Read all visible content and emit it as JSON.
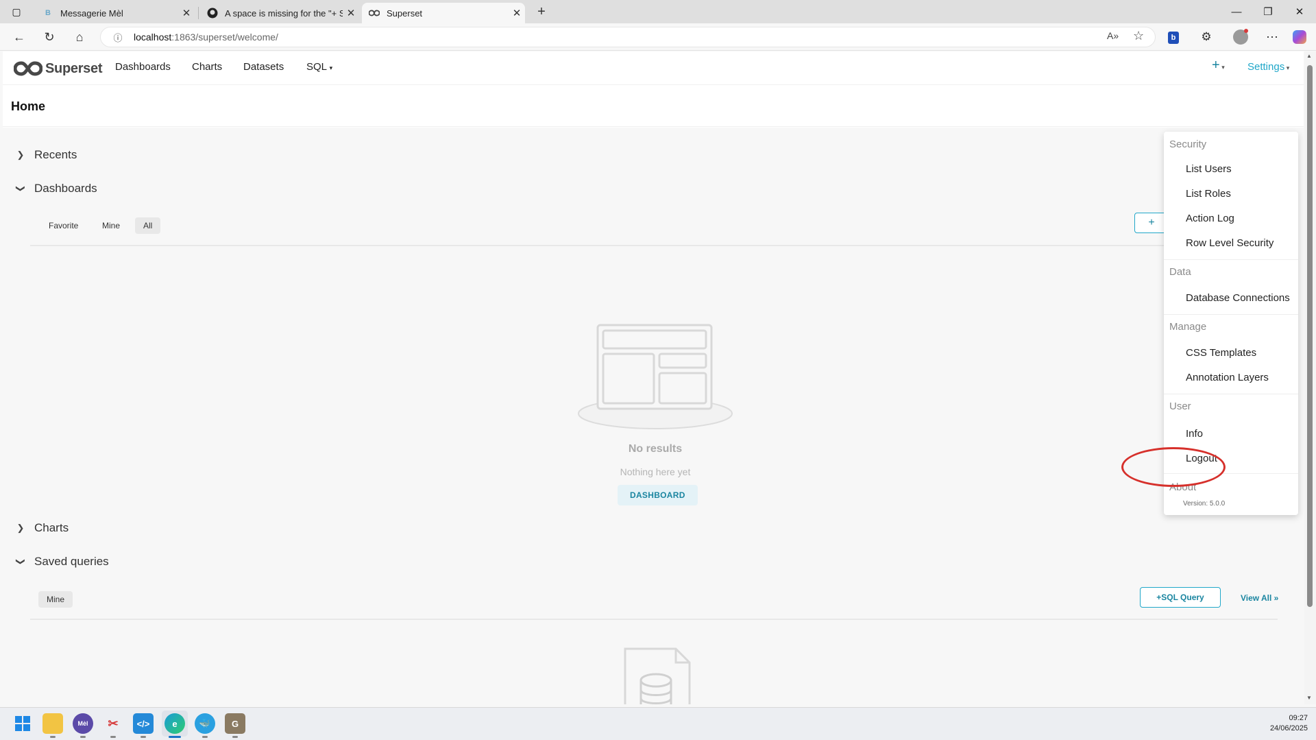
{
  "browser": {
    "tabs": [
      {
        "title": "Messagerie Mèl",
        "icon": "mail-favicon",
        "active": false
      },
      {
        "title": "A space is missing for the \"+ SQL",
        "icon": "github-icon",
        "active": false
      },
      {
        "title": "Superset",
        "icon": "superset-favicon",
        "active": true
      }
    ],
    "url": {
      "host": "localhost",
      "path": ":1863/superset/welcome/"
    }
  },
  "app": {
    "brand": "Superset",
    "nav": [
      "Dashboards",
      "Charts",
      "Datasets",
      "SQL"
    ],
    "plus_label": "+",
    "settings_label": "Settings",
    "page_title": "Home"
  },
  "sections": {
    "recents": "Recents",
    "dashboards": {
      "title": "Dashboards",
      "filters": [
        "Favorite",
        "Mine",
        "All"
      ],
      "selected_filter": "All",
      "new_button": "+",
      "empty_title": "No results",
      "empty_subtitle": "Nothing here yet",
      "empty_button": "DASHBOARD"
    },
    "charts": "Charts",
    "saved_queries": {
      "title": "Saved queries",
      "filters": [
        "Mine"
      ],
      "new_button": "+SQL Query",
      "view_all": "View All »"
    }
  },
  "settings_menu": {
    "groups": [
      {
        "label": "Security",
        "items": [
          "List Users",
          "List Roles",
          "Action Log",
          "Row Level Security"
        ]
      },
      {
        "label": "Data",
        "items": [
          "Database Connections"
        ]
      },
      {
        "label": "Manage",
        "items": [
          "CSS Templates",
          "Annotation Layers"
        ]
      },
      {
        "label": "User",
        "items": [
          "Info",
          "Logout"
        ]
      },
      {
        "label": "About",
        "items": []
      }
    ],
    "version": "Version: 5.0.0"
  },
  "taskbar": {
    "time": "09:27",
    "date": "24/06/2025"
  },
  "colors": {
    "accent": "#20a7c9",
    "annotation": "#d6302b"
  }
}
